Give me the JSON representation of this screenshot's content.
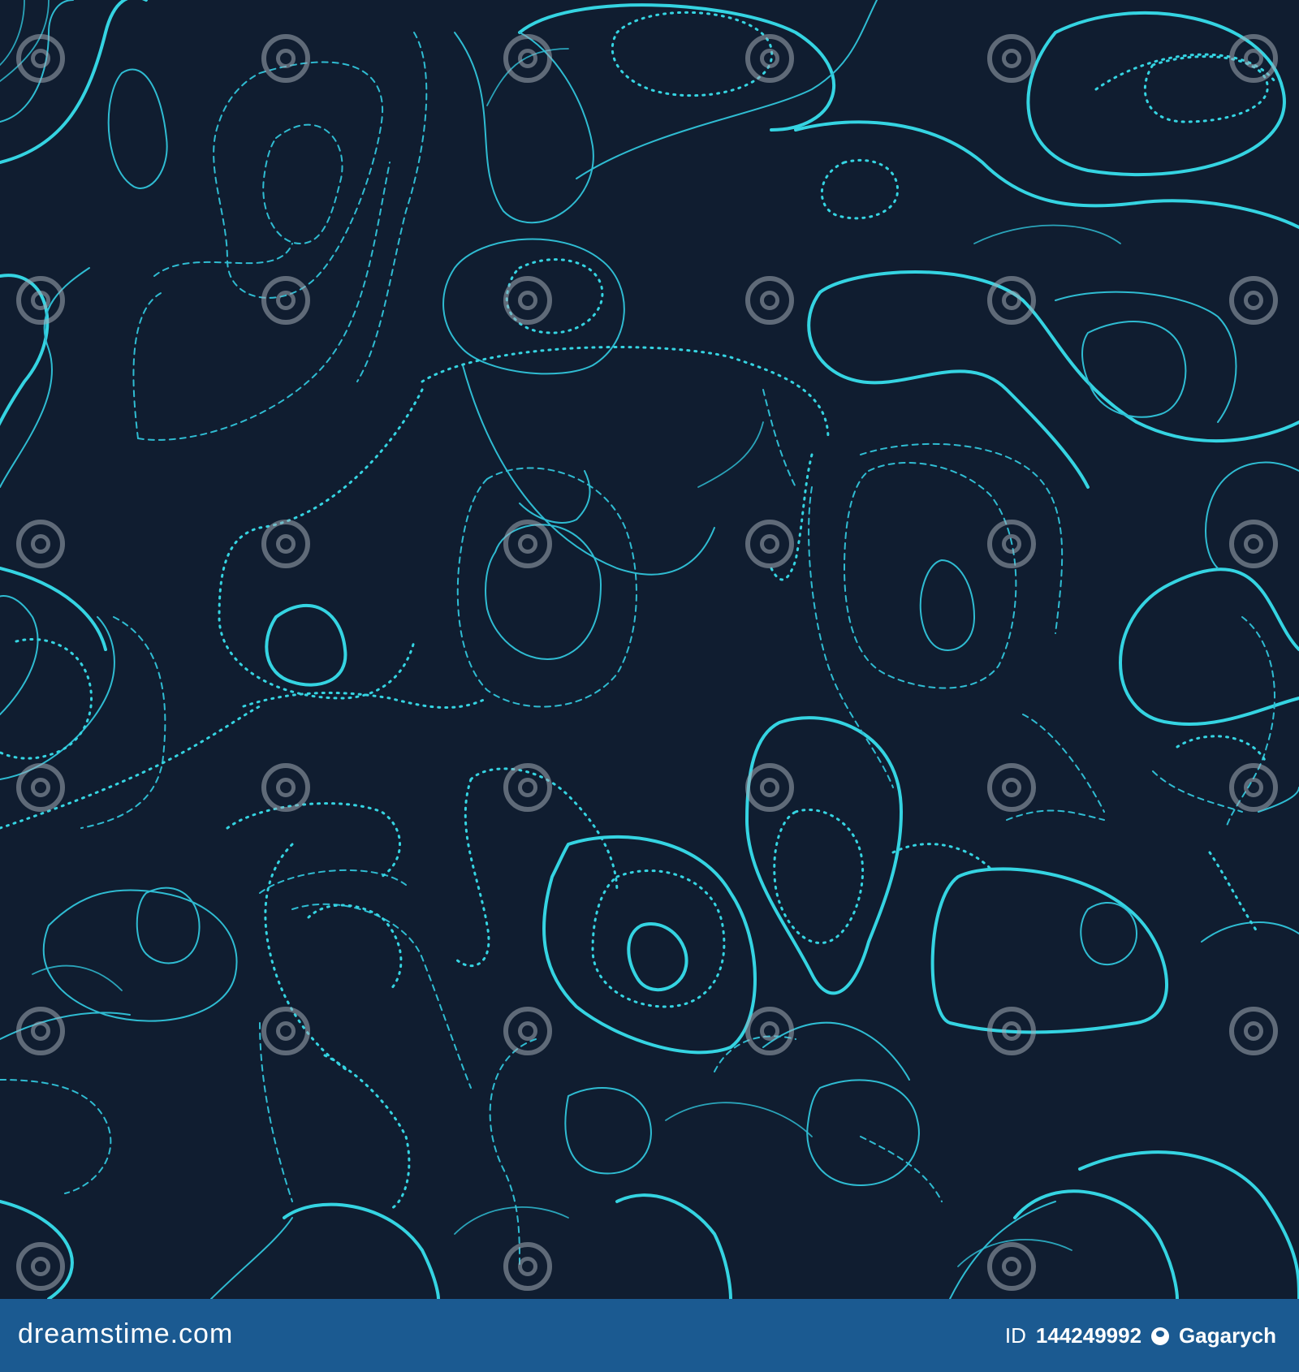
{
  "image": {
    "description_colors": {
      "background": "#101d30",
      "contour_bright": "#33d6e0",
      "contour_soft": "#2fb8cf",
      "footer_bg": "#1b5a91"
    },
    "watermark_icon": "dreamstime-spiral-icon"
  },
  "footer": {
    "brand": "dreamstime.com",
    "id_label": "ID",
    "id_value": "144249992",
    "author_icon": "copyright-icon",
    "author": "Gagarych"
  }
}
